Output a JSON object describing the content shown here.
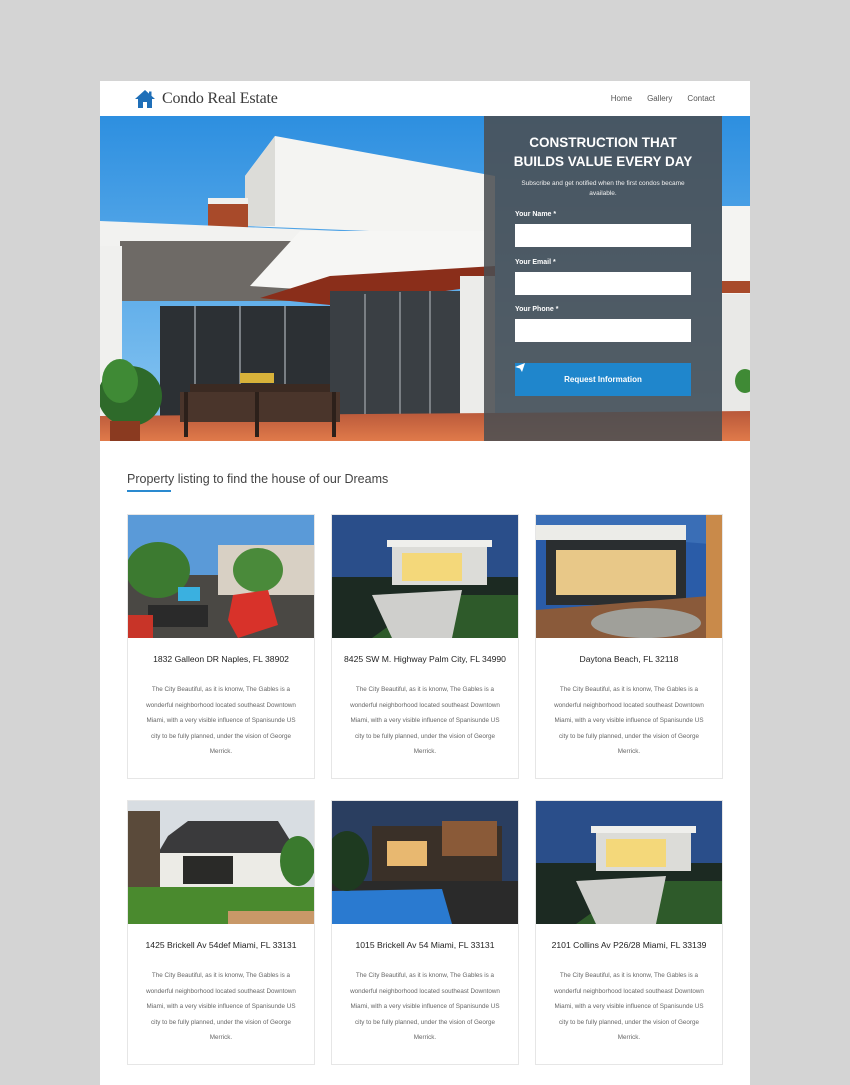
{
  "header": {
    "logo_text": "Condo Real Estate",
    "nav": [
      "Home",
      "Gallery",
      "Contact"
    ]
  },
  "hero": {
    "title_line1": "CONSTRUCTION THAT",
    "title_line2": "BUILDS VALUE EVERY DAY",
    "subtitle": "Subscribe and get notified when the first condos became available.",
    "fields": [
      {
        "label": "Your Name *",
        "value": "",
        "placeholder": ""
      },
      {
        "label": "Your Email *",
        "value": "",
        "placeholder": ""
      },
      {
        "label": "Your Phone *",
        "value": "",
        "placeholder": ""
      }
    ],
    "submit_label": "Request Information",
    "submit_icon": "paper-plane-icon"
  },
  "listing": {
    "title": "Property listing to find the house of our Dreams",
    "cards": [
      {
        "title": "1832 Galleon DR Naples, FL 38902",
        "description": "The City Beautiful, as it is knonw, The Gables is a wonderful neighborhood located southeast Downtown Miami, with a very visible influence of Spanisunde US city to be fully planned, under the vision of George Merrick."
      },
      {
        "title": "8425 SW M. Highway Palm City, FL 34990",
        "description": "The City Beautiful, as it is knonw, The Gables is a wonderful neighborhood located southeast Downtown Miami, with a very visible influence of Spanisunde US city to be fully planned, under the vision of George Merrick."
      },
      {
        "title": "Daytona Beach, FL 32118",
        "description": "The City Beautiful, as it is knonw, The Gables is a wonderful neighborhood located southeast Downtown Miami, with a very visible influence of Spanisunde US city to be fully planned, under the vision of George Merrick."
      },
      {
        "title": "1425 Brickell Av 54def Miami, FL 33131",
        "description": "The City Beautiful, as it is knonw, The Gables is a wonderful neighborhood located southeast Downtown Miami, with a very visible influence of Spanisunde US city to be fully planned, under the vision of George Merrick."
      },
      {
        "title": "1015 Brickell Av 54 Miami, FL 33131",
        "description": "The City Beautiful, as it is knonw, The Gables is a wonderful neighborhood located southeast Downtown Miami, with a very visible influence of Spanisunde US city to be fully planned, under the vision of George Merrick."
      },
      {
        "title": "2101 Collins Av P26/28 Miami, FL 33139",
        "description": "The City Beautiful, as it is knonw, The Gables is a wonderful neighborhood located southeast Downtown Miami, with a very visible influence of Spanisunde US city to be fully planned, under the vision of George Merrick."
      }
    ]
  },
  "colors": {
    "accent": "#1f86cc",
    "page_bg": "#d4d4d4",
    "form_panel": "#4b4e52"
  }
}
